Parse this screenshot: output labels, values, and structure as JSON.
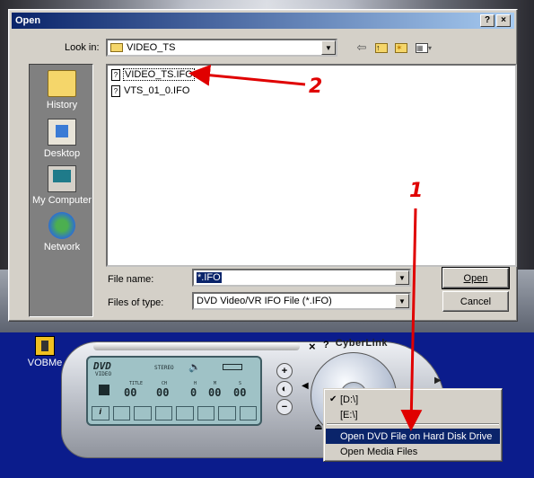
{
  "dialog": {
    "title": "Open",
    "help_btn": "?",
    "close_btn": "×",
    "look_in_label": "Look in:",
    "look_in_value": "VIDEO_TS",
    "places": [
      {
        "label": "History",
        "icon": "history-icon"
      },
      {
        "label": "Desktop",
        "icon": "desktop-icon"
      },
      {
        "label": "My Computer",
        "icon": "computer-icon"
      },
      {
        "label": "Network",
        "icon": "network-icon"
      }
    ],
    "files": [
      "VIDEO_TS.IFO",
      "VTS_01_0.IFO"
    ],
    "file_name_label": "File name:",
    "file_name_value": "*.IFO",
    "file_type_label": "Files of type:",
    "file_type_value": "DVD Video/VR IFO File (*.IFO)",
    "open_btn": "Open",
    "cancel_btn": "Cancel"
  },
  "desktop_icon": {
    "label": "VOBMe"
  },
  "player": {
    "brand": "CyberLink",
    "lcd_logo": "DVD",
    "lcd_sub": "VIDEO",
    "stereo": "STEREO",
    "labels": [
      "TITLE",
      "CH",
      "H",
      "M",
      "S"
    ],
    "values": [
      "00",
      "00",
      "0",
      "00",
      "00"
    ],
    "close": "×",
    "help": "?"
  },
  "menu": {
    "items": [
      {
        "label": "[D:\\]",
        "checked": true
      },
      {
        "label": "[E:\\]",
        "checked": false
      },
      {
        "label": "Open DVD File on Hard Disk Drive",
        "highlighted": true
      },
      {
        "label": "Open Media Files"
      }
    ]
  },
  "annotations": {
    "one": "1",
    "two": "2",
    "color": "#e00000"
  }
}
